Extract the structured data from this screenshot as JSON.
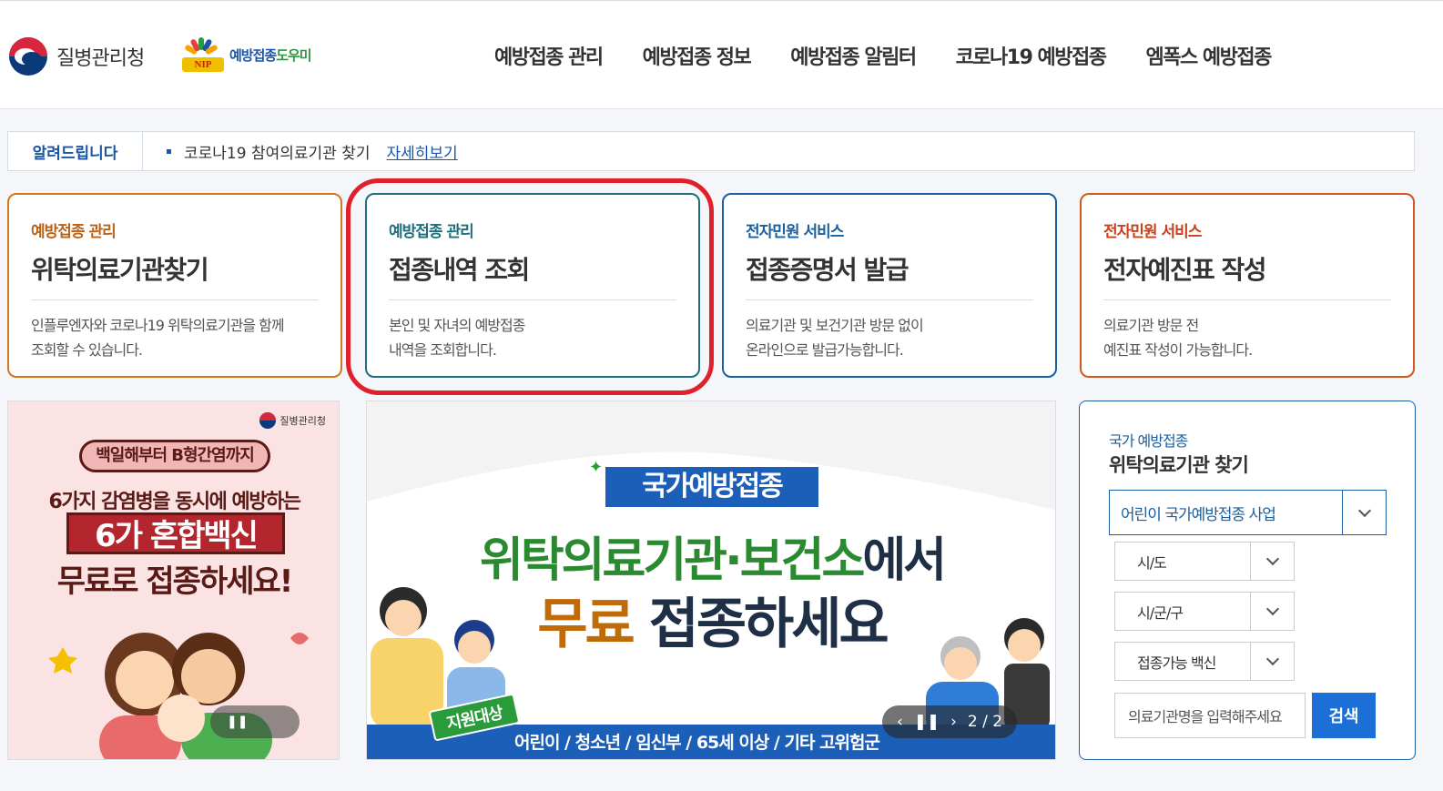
{
  "header": {
    "org_name": "질병관리청",
    "nip_badge": "NIP",
    "nip_name_a": "예방접종",
    "nip_name_b": "도우미",
    "nav": [
      "예방접종 관리",
      "예방접종 정보",
      "예방접종 알림터",
      "코로나19 예방접종",
      "엠폭스 예방접종"
    ]
  },
  "notice": {
    "label": "알려드립니다",
    "text": "코로나19 참여의료기관 찾기",
    "more": "자세히보기"
  },
  "cards": [
    {
      "category": "예방접종 관리",
      "title": "위탁의료기관찾기",
      "desc1": "인플루엔자와 코로나19 위탁의료기관을 함께",
      "desc2": "조회할 수 있습니다."
    },
    {
      "category": "예방접종 관리",
      "title": "접종내역 조회",
      "desc1": "본인 및 자녀의 예방접종",
      "desc2": "내역을 조회합니다."
    },
    {
      "category": "전자민원 서비스",
      "title": "접종증명서 발급",
      "desc1": "의료기관 및 보건기관 방문 없이",
      "desc2": "온라인으로 발급가능합니다."
    },
    {
      "category": "전자민원 서비스",
      "title": "전자예진표 작성",
      "desc1": "의료기관 방문 전",
      "desc2": "예진표 작성이 가능합니다."
    }
  ],
  "banner_left": {
    "org": "질병관리청",
    "pill": "백일해부터 B형간염까지",
    "line1": "6가지 감염병을 동시에 예방하는",
    "line2": "6가 혼합백신",
    "line3": "무료로 접종하세요!",
    "pause": "❚❚"
  },
  "banner_mid": {
    "tag": "국가예방접종",
    "headline_green": "위탁의료기관·보건소",
    "headline_dark": "에서",
    "sub_orange": "무료",
    "sub_dark": " 접종하세요",
    "target_label": "지원대상",
    "target_text": "어린이 / 청소년 / 임신부 / 65세 이상 / 기타 고위험군",
    "prev": "‹",
    "pause": "❚❚",
    "next": "›",
    "pager": "2 / 2"
  },
  "finder": {
    "subtitle": "국가 예방접종",
    "title": "위탁의료기관 찾기",
    "program": "어린이 국가예방접종 사업",
    "region": "시/도",
    "district": "시/군/구",
    "vaccine": "접종가능 백신",
    "search_placeholder": "의료기관명을 입력해주세요",
    "search_button": "검색"
  },
  "colors": {
    "primary_blue": "#1a5f9e",
    "highlight_red": "#e0202a",
    "orange": "#d2771e",
    "teal": "#1e6f7d"
  }
}
